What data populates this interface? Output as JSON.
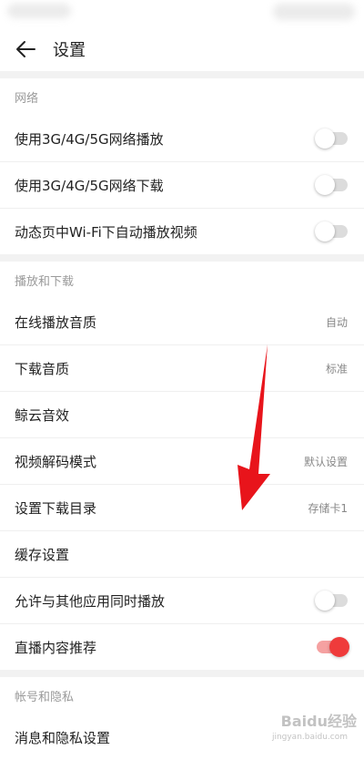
{
  "header": {
    "title": "设置"
  },
  "sections": [
    {
      "title": "网络",
      "rows": [
        {
          "label": "使用3G/4G/5G网络播放",
          "toggle": "off"
        },
        {
          "label": "使用3G/4G/5G网络下载",
          "toggle": "off"
        },
        {
          "label": "动态页中Wi-Fi下自动播放视频",
          "toggle": "off"
        }
      ]
    },
    {
      "title": "播放和下载",
      "rows": [
        {
          "label": "在线播放音质",
          "value": "自动"
        },
        {
          "label": "下载音质",
          "value": "标准"
        },
        {
          "label": "鲸云音效"
        },
        {
          "label": "视频解码模式",
          "value": "默认设置"
        },
        {
          "label": "设置下载目录",
          "value": "存储卡1"
        },
        {
          "label": "缓存设置"
        },
        {
          "label": "允许与其他应用同时播放",
          "toggle": "off"
        },
        {
          "label": "直播内容推荐",
          "toggle": "on"
        }
      ]
    },
    {
      "title": "帐号和隐私",
      "rows": [
        {
          "label": "消息和隐私设置"
        }
      ]
    }
  ],
  "watermark": {
    "text": "Baidu经验",
    "sub": "jingyan.baidu.com"
  },
  "colors": {
    "accent": "#ef3b3b",
    "arrow": "#e8141b"
  }
}
